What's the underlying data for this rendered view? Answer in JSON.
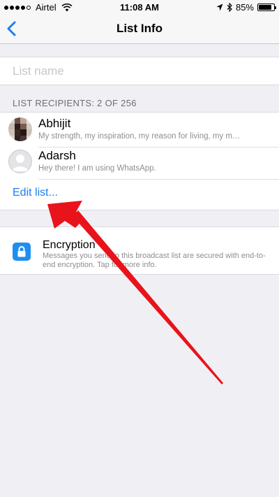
{
  "status_bar": {
    "carrier": "Airtel",
    "time": "11:08 AM",
    "battery_percent": "85%",
    "battery_level": 0.85,
    "signal_bars": 4
  },
  "nav": {
    "title": "List Info",
    "back_icon": "chevron-left-icon"
  },
  "list_name": {
    "placeholder": "List name",
    "value": ""
  },
  "recipients": {
    "header": "LIST RECIPIENTS: 2 OF 256",
    "items": [
      {
        "name": "Abhijit",
        "status": "My strength, my inspiration, my reason for living, my man. I l..."
      },
      {
        "name": "Adarsh",
        "status": "Hey there! I am using WhatsApp."
      }
    ],
    "edit_label": "Edit list..."
  },
  "encryption": {
    "title": "Encryption",
    "description": "Messages you send to this broadcast list are secured with end-to-end encryption. Tap for more info."
  },
  "colors": {
    "accent": "#1a7ff0",
    "lock_tile": "#1e8ff0",
    "annotation_arrow": "#e8131b",
    "background": "#efeff4"
  }
}
